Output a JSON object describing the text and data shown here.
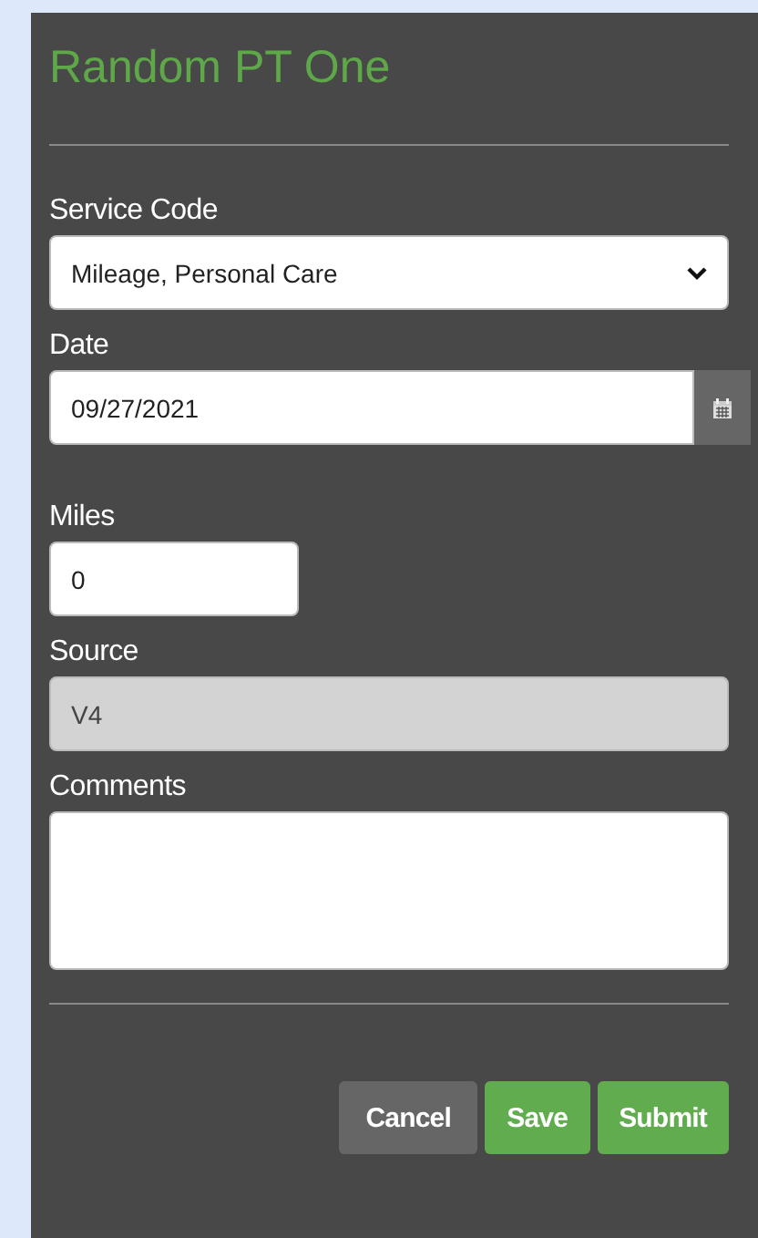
{
  "title": "Random PT One",
  "fields": [
    {
      "kind": "select",
      "label": "Service Code",
      "value": "Mileage, Personal Care",
      "disabled": false
    },
    {
      "kind": "date",
      "label": "Date",
      "value": "09/27/2021",
      "disabled": false
    },
    {
      "kind": "number",
      "label": "Miles",
      "value": "0",
      "disabled": false
    },
    {
      "kind": "text",
      "label": "Source",
      "value": "V4",
      "disabled": true
    },
    {
      "kind": "textarea",
      "label": "Comments",
      "disabled": false
    }
  ],
  "buttons": [
    {
      "label": "Cancel",
      "kind": "secondary"
    },
    {
      "label": "Save",
      "kind": "primary"
    },
    {
      "label": "Submit",
      "kind": "primary"
    }
  ]
}
